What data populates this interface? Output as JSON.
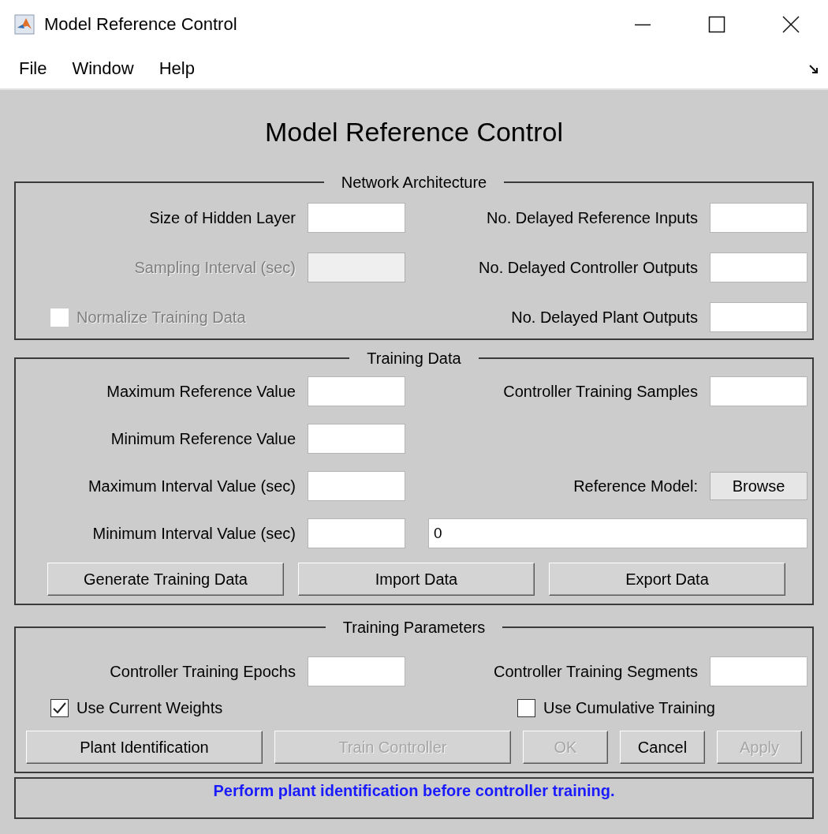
{
  "window": {
    "title": "Model Reference Control"
  },
  "menu": [
    "File",
    "Window",
    "Help"
  ],
  "heading": "Model Reference Control",
  "panels": [
    {
      "title": "Network Architecture",
      "rows": [
        {
          "left": {
            "kind": "field",
            "label": "Size of Hidden Layer",
            "disabled": false
          },
          "right": {
            "kind": "field",
            "label": "No. Delayed Reference Inputs",
            "disabled": false
          }
        },
        {
          "left": {
            "kind": "field",
            "label": "Sampling Interval (sec)",
            "disabled": true
          },
          "right": {
            "kind": "field",
            "label": "No. Delayed Controller Outputs",
            "disabled": false
          }
        },
        {
          "left": {
            "kind": "checkbox",
            "label": "Normalize Training Data",
            "checked": false,
            "disabled": true
          },
          "right": {
            "kind": "field",
            "label": "No. Delayed Plant Outputs",
            "disabled": false
          }
        }
      ]
    },
    {
      "title": "Training Data",
      "rows": [
        {
          "left": {
            "kind": "field",
            "label": "Maximum Reference Value",
            "disabled": false
          },
          "right": {
            "kind": "field",
            "label": "Controller Training Samples",
            "disabled": false
          }
        },
        {
          "left": {
            "kind": "field",
            "label": "Minimum Reference Value",
            "disabled": false
          }
        },
        {
          "left": {
            "kind": "field",
            "label": "Maximum Interval Value (sec)",
            "disabled": false
          },
          "right": {
            "kind": "browse",
            "label": "Reference Model:",
            "button": "Browse"
          }
        },
        {
          "left": {
            "kind": "field",
            "label": "Minimum Interval Value (sec)",
            "disabled": false
          },
          "right": {
            "kind": "text",
            "value": "0"
          }
        }
      ],
      "buttons": [
        {
          "label": "Generate Training Data",
          "disabled": false
        },
        {
          "label": "Import Data",
          "disabled": false
        },
        {
          "label": "Export Data",
          "disabled": false
        }
      ]
    },
    {
      "title": "Training Parameters",
      "rows": [
        {
          "left": {
            "kind": "field",
            "label": "Controller Training Epochs",
            "disabled": false
          },
          "right": {
            "kind": "field",
            "label": "Controller Training Segments",
            "disabled": false
          }
        },
        {
          "left": {
            "kind": "checkbox",
            "label": "Use Current Weights",
            "checked": true,
            "disabled": false
          },
          "right": {
            "kind": "checkbox",
            "label": "Use Cumulative Training",
            "checked": false,
            "disabled": false
          }
        }
      ],
      "buttons": [
        {
          "label": "Plant Identification",
          "disabled": false
        },
        {
          "label": "Train Controller",
          "disabled": true
        },
        {
          "label": "OK",
          "disabled": true
        },
        {
          "label": "Cancel",
          "disabled": false
        },
        {
          "label": "Apply",
          "disabled": true
        }
      ]
    }
  ],
  "status": "Perform plant identification before controller training."
}
